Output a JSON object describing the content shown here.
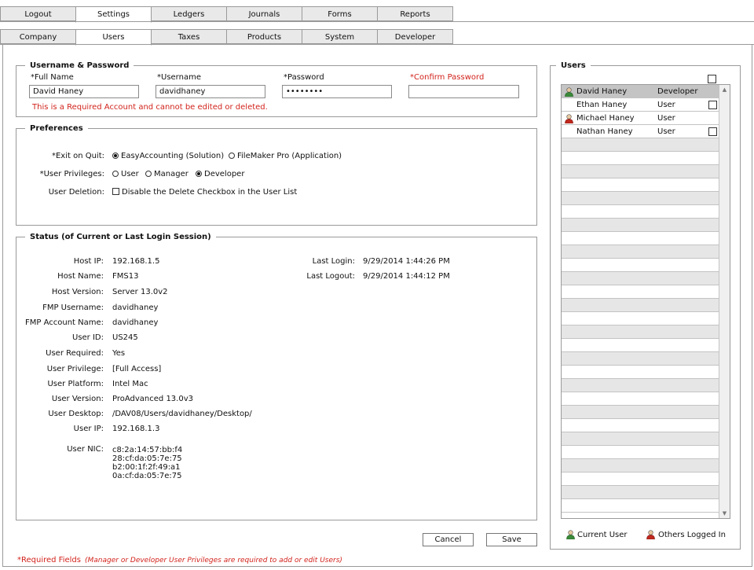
{
  "tabs_main": [
    "Logout",
    "Settings",
    "Ledgers",
    "Journals",
    "Forms",
    "Reports"
  ],
  "tabs_sub": [
    "Company",
    "Users",
    "Taxes",
    "Products",
    "System",
    "Developer"
  ],
  "userpass": {
    "legend": "Username & Password",
    "fullname_label": "*Full Name",
    "fullname_value": "David Haney",
    "username_label": "*Username",
    "username_value": "davidhaney",
    "password_label": "*Password",
    "password_value": "••••••••",
    "confirm_label": "*Confirm Password",
    "confirm_value": "",
    "required_note": "This is a Required Account and cannot be edited or deleted."
  },
  "prefs": {
    "legend": "Preferences",
    "exit_label": "*Exit on Quit:",
    "exit_opt1": "EasyAccounting (Solution)",
    "exit_opt2": "FileMaker Pro (Application)",
    "priv_label": "*User Privileges:",
    "priv_opt1": "User",
    "priv_opt2": "Manager",
    "priv_opt3": "Developer",
    "deletion_label": "User Deletion:",
    "deletion_opt": "Disable the Delete Checkbox in the User List"
  },
  "status": {
    "legend": "Status (of Current or Last Login Session)",
    "rows": [
      {
        "label": "Host IP:",
        "value": "192.168.1.5"
      },
      {
        "label": "Host Name:",
        "value": "FMS13"
      },
      {
        "label": "Host Version:",
        "value": "Server 13.0v2"
      },
      {
        "label": "FMP Username:",
        "value": "davidhaney"
      },
      {
        "label": "FMP Account Name:",
        "value": "davidhaney"
      },
      {
        "label": "User ID:",
        "value": "US245"
      },
      {
        "label": "User Required:",
        "value": "Yes"
      },
      {
        "label": "User Privilege:",
        "value": "[Full Access]"
      },
      {
        "label": "User Platform:",
        "value": "Intel Mac"
      },
      {
        "label": "User Version:",
        "value": "ProAdvanced 13.0v3"
      },
      {
        "label": "User Desktop:",
        "value": "/DAV08/Users/davidhaney/Desktop/"
      },
      {
        "label": "User IP:",
        "value": "192.168.1.3"
      }
    ],
    "nic_label": "User NIC:",
    "nic_values": [
      "c8:2a:14:57:bb:f4",
      "28:cf:da:05:7e:75",
      "b2:00:1f:2f:49:a1",
      "0a:cf:da:05:7e:75"
    ],
    "last_login_label": "Last Login:",
    "last_login_value": "9/29/2014  1:44:26 PM",
    "last_logout_label": "Last Logout:",
    "last_logout_value": "9/29/2014  1:44:12 PM"
  },
  "users": {
    "legend": "Users",
    "list": [
      {
        "name": "David Haney",
        "privilege": "Developer",
        "icon": "current-user-icon",
        "checkbox": false
      },
      {
        "name": "Ethan Haney",
        "privilege": "User",
        "icon": "",
        "checkbox": true
      },
      {
        "name": "Michael Haney",
        "privilege": "User",
        "icon": "other-user-icon",
        "checkbox": false
      },
      {
        "name": "Nathan Haney",
        "privilege": "User",
        "icon": "",
        "checkbox": true
      }
    ],
    "legend_current": "Current User",
    "legend_others": "Others Logged In",
    "current_color": "#3a8a3a",
    "other_color": "#c0281e"
  },
  "buttons": {
    "cancel": "Cancel",
    "save": "Save"
  },
  "footer": {
    "required": "*Required Fields",
    "note": "(Manager or Developer User Privileges are required to add or edit Users)"
  }
}
